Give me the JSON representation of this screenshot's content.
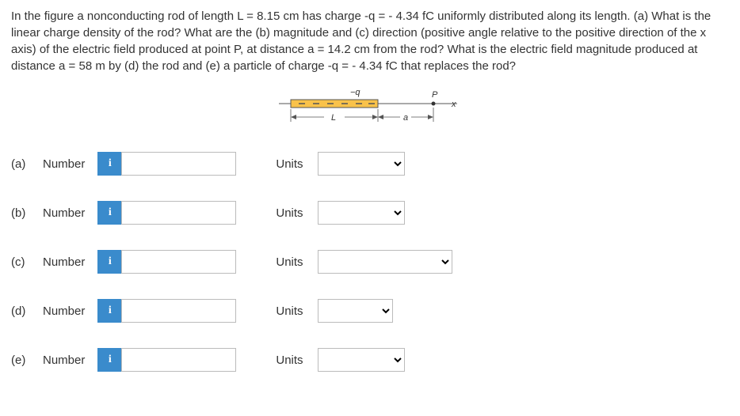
{
  "question": "In the figure a nonconducting rod of length L = 8.15 cm has charge -q = - 4.34 fC uniformly distributed along its length. (a) What is the linear charge density of the rod? What are the (b) magnitude and (c) direction (positive angle relative to the positive direction of the x axis) of the electric field produced at point P, at distance a = 14.2 cm from the rod? What is the electric field magnitude produced at distance a = 58 m by (d) the rod and (e) a particle of charge -q = - 4.34 fC that replaces the rod?",
  "diagram": {
    "minus_q": "−q",
    "P": "P",
    "x": "x",
    "L": "L",
    "a": "a"
  },
  "labels": {
    "number": "Number",
    "units": "Units",
    "info": "i"
  },
  "parts": {
    "a": "(a)",
    "b": "(b)",
    "c": "(c)",
    "d": "(d)",
    "e": "(e)"
  }
}
